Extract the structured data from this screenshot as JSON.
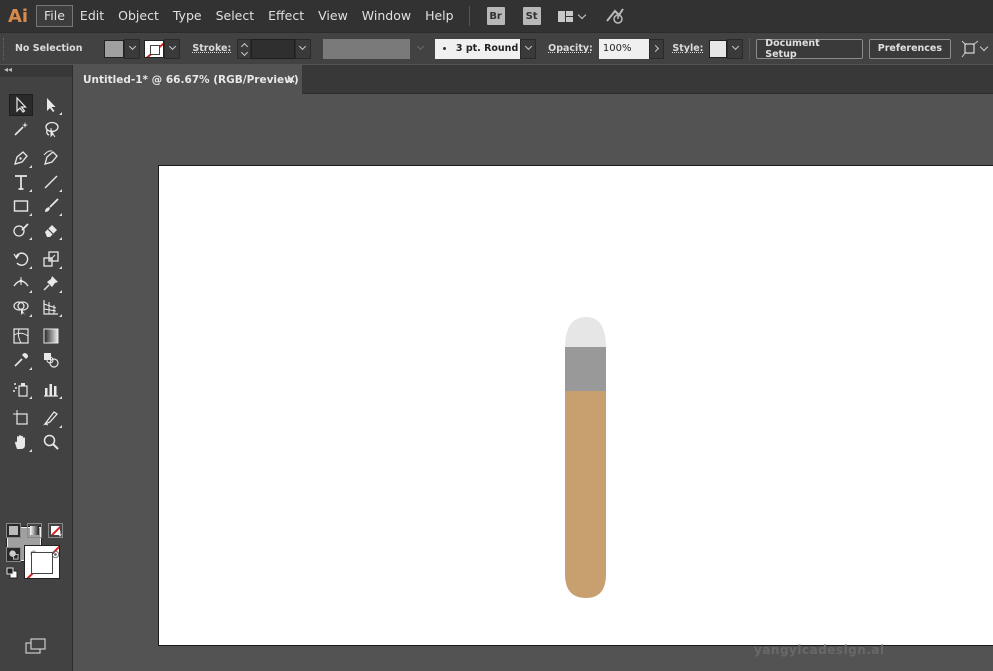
{
  "menubar": {
    "app_logo": "Ai",
    "items": [
      "File",
      "Edit",
      "Object",
      "Type",
      "Select",
      "Effect",
      "View",
      "Window",
      "Help"
    ],
    "active_item": "File",
    "bridge_label": "Br",
    "stock_label": "St"
  },
  "control": {
    "selection_label": "No Selection",
    "fill_color": "#a0a0a0",
    "stroke_label": "Stroke:",
    "brush_label": "3 pt. Round",
    "opacity_label": "Opacity:",
    "opacity_value": "100%",
    "style_label": "Style:",
    "document_setup_label": "Document Setup",
    "preferences_label": "Preferences"
  },
  "toolbar": {
    "collapse_label": "◂◂",
    "fill_color": "#a0a0a0",
    "stroke_color": "none"
  },
  "document": {
    "tab_title": "Untitled-1* @ 66.67% (RGB/Preview)",
    "close_glyph": "×"
  },
  "artwork": {
    "tip_color": "#e6e6e6",
    "band_color": "#999999",
    "body_color": "#c8a070"
  },
  "watermark": {
    "text": "yangyicadesign.ai"
  }
}
